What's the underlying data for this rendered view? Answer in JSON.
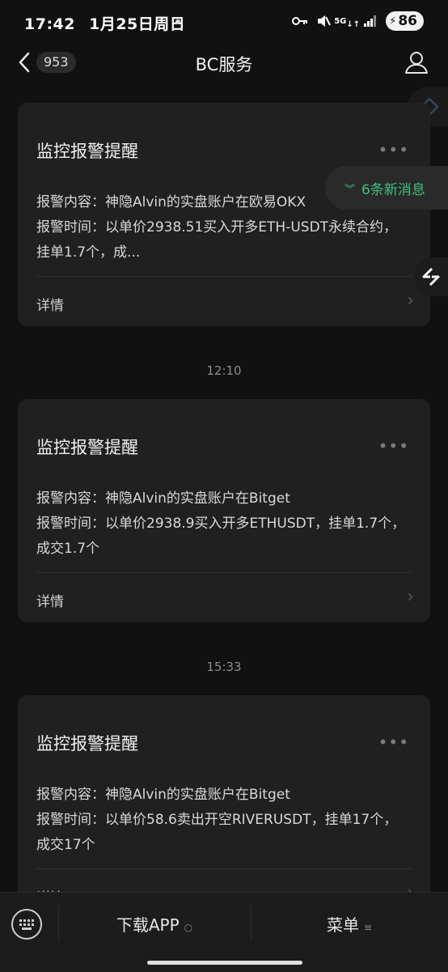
{
  "status_bar": {
    "time": "17:42",
    "date": "1月25日周日",
    "network": "5G",
    "battery": "86"
  },
  "nav": {
    "back_count": "953",
    "title": "BC服务"
  },
  "floating": {
    "new_messages": "6条新消息"
  },
  "messages": [
    {
      "title": "监控报警提醒",
      "line1": "报警内容：神隐Alvin的实盘账户在欧易OKX",
      "line2": "报警时间：以单价2938.51买入开多ETH-USDT永续合约，挂单1.7个，成...",
      "detail": "详情"
    },
    {
      "timestamp": "12:10",
      "title": "监控报警提醒",
      "line1": "报警内容：神隐Alvin的实盘账户在Bitget",
      "line2": "报警时间：以单价2938.9买入开多ETHUSDT，挂单1.7个，成交1.7个",
      "detail": "详情"
    },
    {
      "timestamp": "15:33",
      "title": "监控报警提醒",
      "line1": "报警内容：神隐Alvin的实盘账户在Bitget",
      "line2": "报警时间：以单价58.6卖出开空RIVERUSDT，挂单17个，成交17个",
      "detail": "详情"
    }
  ],
  "bottom_bar": {
    "menu1": "下载APP",
    "menu2": "菜单"
  },
  "colors": {
    "background": "#111111",
    "card": "#202020",
    "accent_green": "#3fbf7a"
  }
}
